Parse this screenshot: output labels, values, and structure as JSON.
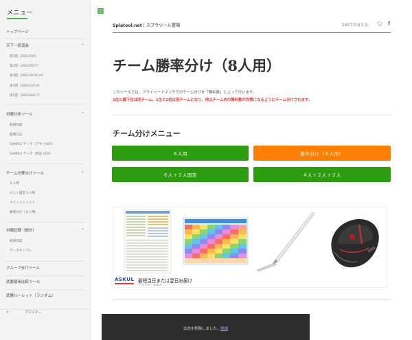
{
  "sidebar": {
    "title": "メニュー",
    "bottom_label": "ブフイマー",
    "items": [
      {
        "label": "トップページ",
        "type": "top",
        "expandable": false
      },
      {
        "label": "天下一武道会",
        "type": "top",
        "expandable": true
      },
      {
        "label": "第1回（2021/6/6）",
        "type": "sub"
      },
      {
        "label": "第2回（2021/6/27）",
        "type": "sub"
      },
      {
        "label": "第3回（2021/8/28-29）",
        "type": "sub"
      },
      {
        "label": "第4回（2022/2/5-6）",
        "type": "sub"
      },
      {
        "label": "第5回（2022/8/6-7）",
        "type": "sub"
      },
      {
        "label": "対戦分析ツール",
        "type": "top",
        "expandable": true
      },
      {
        "label": "新規作成",
        "type": "sub"
      },
      {
        "label": "使用方法",
        "type": "sub"
      },
      {
        "label": "SAMPLE データ（アサリVER）",
        "type": "sub"
      },
      {
        "label": "SAMPLE データ（明石 VER）",
        "type": "sub"
      },
      {
        "label": "チーム均等分けツール",
        "type": "top",
        "expandable": true
      },
      {
        "label": "８人用",
        "type": "sub"
      },
      {
        "label": "６人＋固定２人用",
        "type": "sub"
      },
      {
        "label": "４人＋２人＋２人",
        "type": "sub"
      },
      {
        "label": "勝率分け（８人用）",
        "type": "sub"
      },
      {
        "label": "対戦記録（統計）",
        "type": "top",
        "expandable": true
      },
      {
        "label": "新規作成",
        "type": "sub"
      },
      {
        "label": "データサンプル",
        "type": "sub"
      },
      {
        "label": "グループ分けツール",
        "type": "top",
        "expandable": false
      },
      {
        "label": "武器使用比較ツール",
        "type": "top",
        "expandable": false
      },
      {
        "label": "武器ルーレット（ランダム）",
        "type": "top",
        "expandable": false
      }
    ]
  },
  "header": {
    "site_name_bold": "Splatool.net",
    "site_name_rest": " | スプラツール置場",
    "share_label": "SNSで共有する:",
    "twitter_icon": "twitter-icon",
    "facebook_icon": "facebook-icon"
  },
  "main": {
    "title": "チーム勝率分け（8人用）",
    "description": "このツールでは、プライベートマッチでのチーム分けを「勝利数」によって行います。",
    "note": "1位と最下位は同チーム、1位と2位は別チームになり、他はチーム内の勝利数が均等になるようにチーム分けされます。",
    "menu_title": "チーム分けメニュー",
    "buttons": [
      {
        "label": "８人用",
        "color": "#2c9d0f"
      },
      {
        "label": "勝率分け（８人用）",
        "color": "#ff7f00"
      },
      {
        "label": "６人＋２人固定",
        "color": "#2c9d0f"
      },
      {
        "label": "４人＋２人＋２人",
        "color": "#2c9d0f"
      }
    ]
  },
  "ad": {
    "brand": "ASKUL",
    "headline": "最短当日または翌日お届け",
    "sub": "アスクル - askul",
    "info_icon": "ad-info-icon",
    "close_icon": "ad-close-icon",
    "images": [
      "document-chart-image",
      "colorful-table-image",
      "sword-image",
      "gaming-mouse-image"
    ]
  },
  "bottom_notice": {
    "message": "広告を削除しました。",
    "link": "詳細"
  },
  "colors": {
    "accent_green": "#4caf50",
    "button_green": "#2c9d0f",
    "button_orange": "#ff7f00",
    "note_red": "#e53935"
  }
}
